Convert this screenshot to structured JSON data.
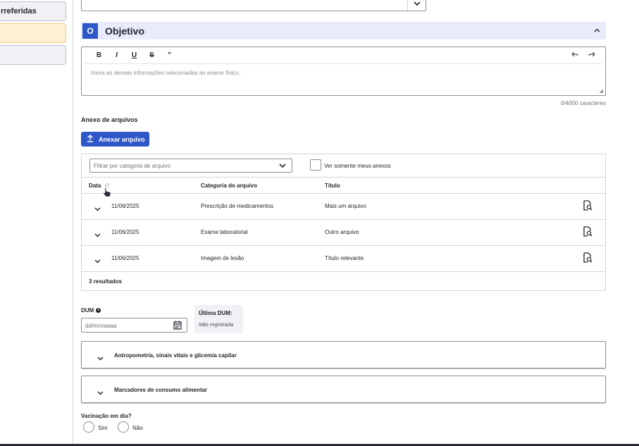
{
  "sidebar": {
    "items": [
      {
        "label": "rreferidas"
      },
      {
        "label": ""
      },
      {
        "label": ""
      }
    ]
  },
  "objetivo": {
    "letter": "O",
    "title": "Objetivo"
  },
  "editor": {
    "toolbar": {
      "bold": "B",
      "italic": "I",
      "underline": "U",
      "strike": "S",
      "quote": "”"
    },
    "placeholder": "Insira as demais informações relacionadas ao exame físico.",
    "counter": "0/4000 caracteres"
  },
  "attachments": {
    "section_title": "Anexo de arquivos",
    "attach_button": "Anexar arquivo",
    "filter_placeholder": "Filtrar por categoria de arquivo",
    "only_mine_label": "Ver somente meus anexos",
    "columns": [
      "Data",
      "Categoria do arquivo",
      "Título"
    ],
    "rows": [
      {
        "date": "11/06/2025",
        "category": "Prescrição de medicamentos",
        "title": "Mais um arquivo"
      },
      {
        "date": "11/06/2025",
        "category": "Exame laboratorial",
        "title": "Outro arquivo"
      },
      {
        "date": "11/06/2025",
        "category": "Imagem de lesão",
        "title": "Título relevante"
      }
    ],
    "results": "3 resultados"
  },
  "dum": {
    "label": "DUM",
    "placeholder": "dd/mm/aaaa",
    "last_title": "Última DUM:",
    "last_value": "Não registrada"
  },
  "sections": {
    "antropometria": "Antropometria, sinais vitais e glicemia capilar",
    "marcadores": "Marcadores de consumo alimentar"
  },
  "vacinacao": {
    "question": "Vacinação em dia?",
    "options": [
      "Sim",
      "Não"
    ]
  },
  "colors": {
    "primary": "#2e58c8",
    "header_bg": "#e8ecfa",
    "selected_side": "#fff0d4"
  }
}
